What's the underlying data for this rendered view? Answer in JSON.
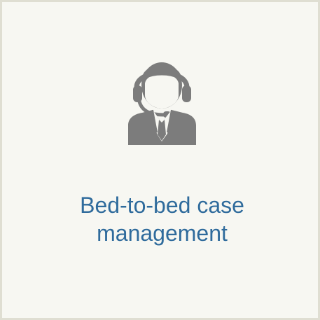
{
  "card": {
    "icon": "customer-support-agent-headset-icon",
    "title": "Bed-to-bed case\nmanagement",
    "colors": {
      "background": "#f7f7f2",
      "border": "#dfded2",
      "icon": "#7c7c7c",
      "text": "#2f6b9c"
    }
  }
}
